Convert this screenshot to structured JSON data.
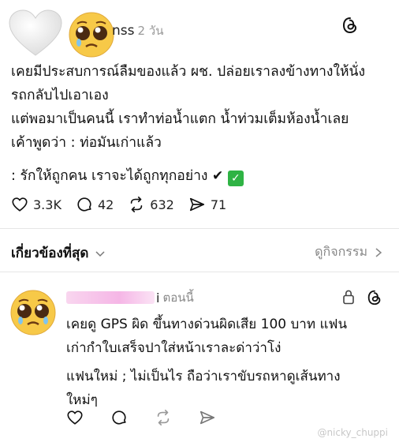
{
  "post": {
    "author_suffix": "nss",
    "time": "2 วัน",
    "body_lines": [
      "เคยมีประสบการณ์ลืมของแล้ว ผช. ปล่อยเราลงข้างทางให้นั่ง",
      "รถกลับไปเอาเอง",
      "แต่พอมาเป็นคนนี้ เราทำท่อน้ำแตก น้ำท่วมเต็มห้องน้ำเลย",
      "เค้าพูดว่า : ท่อมันเก่าแล้ว"
    ],
    "closing_line": ": รักให้ถูกคน  เราจะได้ถูกทุกอย่าง",
    "check_dark": "✔",
    "check_green": "✓",
    "actions": {
      "likes": "3.3K",
      "comments": "42",
      "reposts": "632",
      "shares": "71"
    }
  },
  "related_bar": {
    "left_label": "เกี่ยวข้องที่สุด",
    "right_label": "ดูกิจกรรม"
  },
  "reply": {
    "name_tail": "i",
    "time": "ตอนนี้",
    "body_lines_1": [
      "เคยดู GPS ผิด ขึ้นทางด่วนผิดเสีย 100 บาท แฟน",
      "เก่ากำใบเสร็จปาใส่หน้าเราละด่าว่าโง่"
    ],
    "body_lines_2": [
      "แฟนใหม่ ; ไม่เป็นไร ถือว่าเราขับรถหาดูเส้นทาง",
      "ใหม่ๆ"
    ]
  },
  "watermark": "@nicky_chuppi",
  "icons": {
    "threads": "threads-logo-icon",
    "heart": "heart-icon",
    "comment": "comment-bubble-icon",
    "repost": "repost-icon",
    "share": "send-icon",
    "lock": "lock-icon",
    "chevron_down": "chevron-down-icon",
    "chevron_right": "chevron-right-icon"
  },
  "colors": {
    "green_check": "#2fb344",
    "muted_text": "#888888",
    "redaction_pink": "#f5b6e6"
  }
}
